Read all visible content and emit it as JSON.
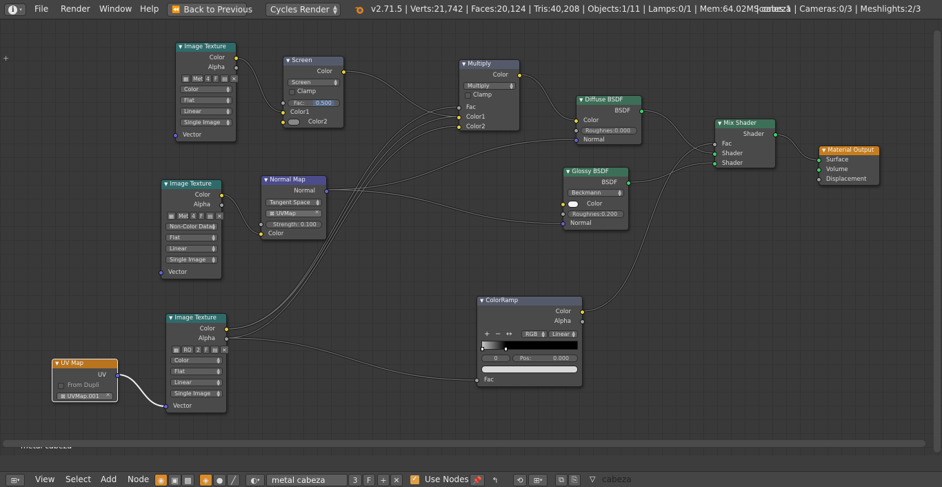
{
  "topbar": {
    "menus": [
      "File",
      "Render",
      "Window",
      "Help"
    ],
    "back_label": "Back to Previous",
    "engine": "Cycles Render",
    "stats": "v2.71.5 | Verts:21,742 | Faces:20,124 | Tris:40,208 | Objects:1/11 | Lamps:0/1 | Mem:64.02M | cabeza",
    "scene_stats": "Scenes:1 | Cameras:0/3 | Meshlights:2/3"
  },
  "editor": {
    "material_label": "metal cabeza"
  },
  "nodes": {
    "tex1": {
      "title": "Image Texture",
      "out1": "Color",
      "out2": "Alpha",
      "img": "Met",
      "num": "4",
      "f": "F",
      "color_space": "Color",
      "projection": "Flat",
      "interp": "Linear",
      "source": "Single Image",
      "in1": "Vector"
    },
    "tex2": {
      "title": "Image Texture",
      "out1": "Color",
      "out2": "Alpha",
      "img": "Met",
      "num": "4",
      "f": "F",
      "color_space": "Non-Color Data",
      "projection": "Flat",
      "interp": "Linear",
      "source": "Single Image",
      "in1": "Vector"
    },
    "tex3": {
      "title": "Image Texture",
      "out1": "Color",
      "out2": "Alpha",
      "img": "RO",
      "num": "2",
      "f": "F",
      "color_space": "Color",
      "projection": "Flat",
      "interp": "Linear",
      "source": "Single Image",
      "in1": "Vector"
    },
    "screen": {
      "title": "Screen",
      "out1": "Color",
      "mode": "Screen",
      "clamp": "Clamp",
      "fac_label": "Fac:",
      "fac_val": "0.500",
      "in1": "Color1",
      "in2": "Color2"
    },
    "multiply": {
      "title": "Multiply",
      "out1": "Color",
      "mode": "Multiply",
      "clamp": "Clamp",
      "in0": "Fac",
      "in1": "Color1",
      "in2": "Color2"
    },
    "diffuse": {
      "title": "Diffuse BSDF",
      "out1": "BSDF",
      "in1": "Color",
      "rough": "Roughnes:0.000",
      "in3": "Normal"
    },
    "glossy": {
      "title": "Glossy BSDF",
      "out1": "BSDF",
      "dist": "Beckmann",
      "in1": "Color",
      "rough": "Roughnes:0.200",
      "in3": "Normal"
    },
    "normalmap": {
      "title": "Normal Map",
      "out1": "Normal",
      "space": "Tangent Space",
      "uv": "UVMap",
      "strength": "Strength: 0.100",
      "in1": "Color"
    },
    "mix": {
      "title": "Mix Shader",
      "out1": "Shader",
      "in0": "Fac",
      "in1": "Shader",
      "in2": "Shader"
    },
    "output": {
      "title": "Material Output",
      "in1": "Surface",
      "in2": "Volume",
      "in3": "Displacement"
    },
    "ramp": {
      "title": "ColorRamp",
      "out1": "Color",
      "out2": "Alpha",
      "plus": "+",
      "minus": "−",
      "flip": "↔",
      "mode": "RGB",
      "interp": "Linear",
      "index": "0",
      "pos": "Pos:",
      "pos_val": "0.000",
      "in1": "Fac"
    },
    "uvmap": {
      "title": "UV Map",
      "out1": "UV",
      "from_dupli": "From Dupli",
      "map": "UVMap.001"
    }
  },
  "bottombar": {
    "menus": [
      "View",
      "Select",
      "Add",
      "Node"
    ],
    "material_name": "metal cabeza",
    "users": "3",
    "fake": "F",
    "use_nodes_label": "Use Nodes",
    "object_name": "cabeza"
  },
  "colors": {
    "texture_header": "#2f6a6a",
    "shader_header": "#3d6e58",
    "output_header": "#c77d1d",
    "link": "#1e1e1e",
    "socket_color": "#e6d23e",
    "socket_shader": "#3ed26a",
    "socket_vector": "#6464d8"
  }
}
